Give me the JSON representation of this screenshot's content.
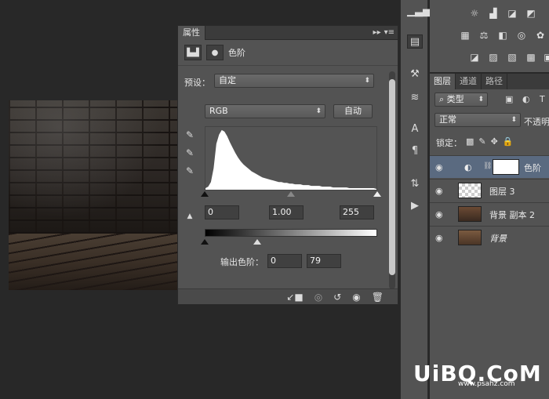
{
  "properties_panel": {
    "tab_title": "属性",
    "adjustment_name": "色阶",
    "preset_label": "预设：",
    "preset_value": "自定",
    "channel_value": "RGB",
    "auto_button": "自动",
    "input_black": "0",
    "input_gamma": "1.00",
    "input_white": "255",
    "output_label": "输出色阶：",
    "output_black": "0",
    "output_white": "79"
  },
  "layers_panel": {
    "tabs": [
      "图层",
      "通道",
      "路径"
    ],
    "filter_kind": "类型",
    "blend_mode": "正常",
    "opacity_label": "不透明",
    "lock_label": "锁定：",
    "layers": [
      {
        "name": "色阶",
        "selected": true
      },
      {
        "name": "图层 3",
        "selected": false
      },
      {
        "name": "背景 副本 2",
        "selected": false
      },
      {
        "name": "背景",
        "selected": false
      }
    ]
  },
  "watermark": {
    "main": "UiBQ.CoM",
    "sub": "www.psahz.com"
  },
  "colors": {
    "panel_bg": "#535353",
    "app_bg": "#282828",
    "selection": "#5a6a80"
  },
  "histogram_levels": [
    2,
    4,
    10,
    28,
    60,
    72,
    78,
    76,
    70,
    62,
    55,
    48,
    42,
    37,
    33,
    30,
    27,
    24,
    22,
    20,
    18,
    16,
    15,
    14,
    13,
    12,
    11,
    10,
    10,
    9,
    9,
    8,
    8,
    7,
    7,
    7,
    6,
    6,
    6,
    5,
    5,
    5,
    5,
    4,
    4,
    4,
    4,
    3,
    3,
    3,
    3,
    3,
    3,
    2,
    2,
    2,
    2,
    2,
    2,
    2,
    2,
    2,
    2,
    1
  ]
}
